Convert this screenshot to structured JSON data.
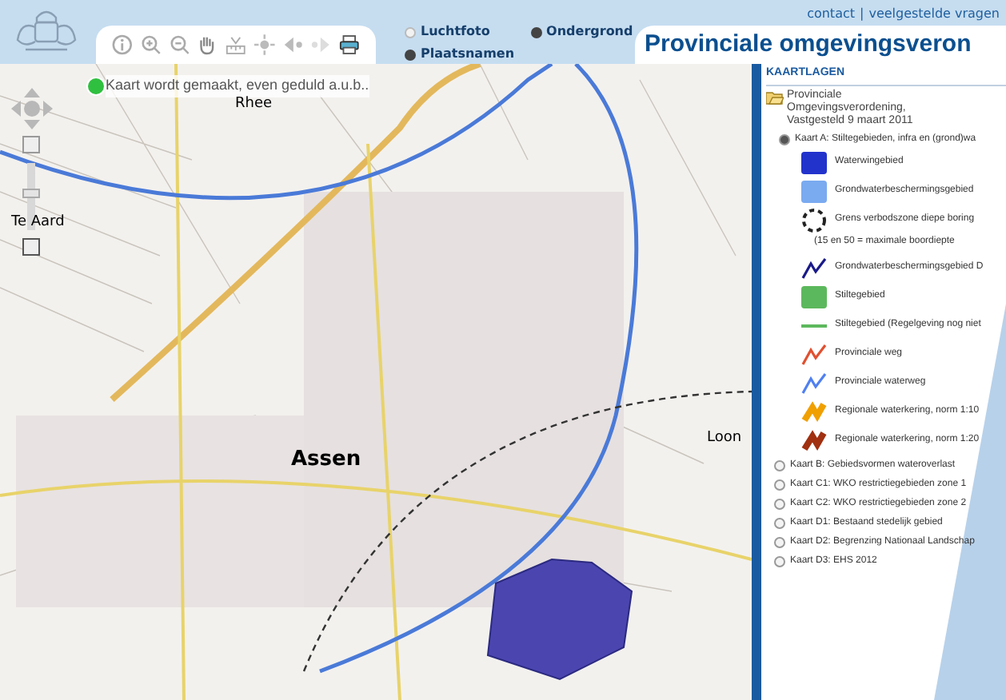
{
  "header": {
    "links": [
      "contact",
      "veelgestelde vragen"
    ],
    "separator": "|",
    "title": "Provinciale omgevingsveron"
  },
  "layer_options": [
    {
      "label": "Luchtfoto",
      "checked": false
    },
    {
      "label": "Ondergrond",
      "checked": true
    },
    {
      "label": "Plaatsnamen",
      "checked": true
    }
  ],
  "map": {
    "zoom": {
      "level": 0.55
    },
    "status": "Kaart wordt gemaakt, even geduld a.u.b..",
    "places": [
      {
        "label": "Rhee",
        "kind": "small"
      },
      {
        "label": "Te Aard",
        "kind": "small"
      },
      {
        "label": "Assen",
        "kind": "large"
      },
      {
        "label": "Loon",
        "kind": "small"
      }
    ]
  },
  "panel": {
    "heading": "KAARTLAGEN",
    "root": "Provinciale Omgevingsverordening, Vastgesteld 9 maart 2011",
    "maps": [
      {
        "label": "Kaart A: Stiltegebieden, infra en (grond)wa",
        "selected": true,
        "legend": [
          {
            "kind": "swatch",
            "color": "#2233cc",
            "label": "Waterwingebied"
          },
          {
            "kind": "swatch",
            "color": "#7aaaf0",
            "label": "Grondwaterbeschermingsgebied"
          },
          {
            "kind": "circle",
            "color": "#222222",
            "label": "Grens verbodszone diepe boring"
          },
          {
            "kind": "note",
            "label": "(15 en 50 = maximale boordiepte"
          },
          {
            "kind": "zigzag",
            "color": "#1a1a8a",
            "label": "Grondwaterbeschermingsgebied D"
          },
          {
            "kind": "swatch",
            "color": "#5cb85c",
            "label": "Stiltegebied"
          },
          {
            "kind": "line",
            "color": "#5cb85c",
            "label": "Stiltegebied (Regelgeving nog niet"
          },
          {
            "kind": "zigzag",
            "color": "#e05030",
            "label": "Provinciale weg"
          },
          {
            "kind": "zigzag",
            "color": "#5080f0",
            "label": "Provinciale waterweg"
          },
          {
            "kind": "thick",
            "color": "#f0a000",
            "label": "Regionale waterkering, norm 1:10"
          },
          {
            "kind": "thick",
            "color": "#a03010",
            "label": "Regionale waterkering, norm 1:20"
          }
        ]
      },
      {
        "label": "Kaart B: Gebiedsvormen wateroverlast",
        "selected": false
      },
      {
        "label": "Kaart C1: WKO restrictiegebieden zone 1",
        "selected": false
      },
      {
        "label": "Kaart C2: WKO restrictiegebieden zone 2",
        "selected": false
      },
      {
        "label": "Kaart D1: Bestaand stedelijk gebied",
        "selected": false
      },
      {
        "label": "Kaart D2: Begrenzing Nationaal Landschap",
        "selected": false
      },
      {
        "label": "Kaart D3: EHS 2012",
        "selected": false
      }
    ]
  }
}
